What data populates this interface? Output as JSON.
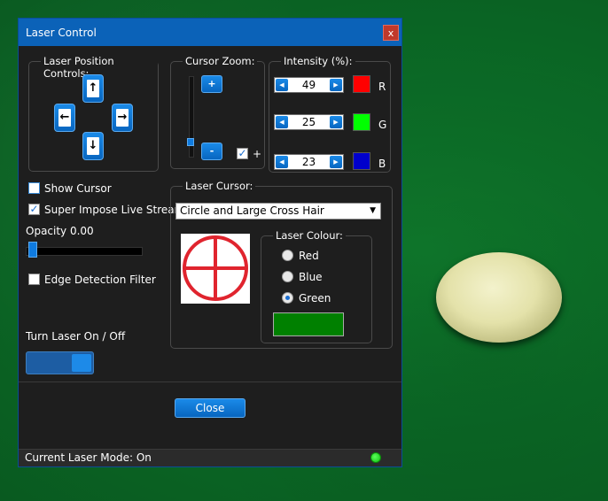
{
  "window": {
    "title": "Laser Control",
    "close_glyph": "x"
  },
  "position_controls": {
    "label": "Laser Position Controls:",
    "up_icon": "arrow-up-icon",
    "down_icon": "arrow-down-icon",
    "left_icon": "arrow-left-icon",
    "right_icon": "arrow-right-icon",
    "up_glyph": "↑",
    "down_glyph": "↓",
    "left_glyph": "←",
    "right_glyph": "→"
  },
  "cursor_zoom": {
    "label": "Cursor Zoom:",
    "plus": "+",
    "minus": "-",
    "check_label": "+",
    "checked": true,
    "level": 0.15
  },
  "intensity": {
    "label": "Intensity (%):",
    "channels": [
      {
        "letter": "R",
        "value": "49",
        "color": "#ff0000"
      },
      {
        "letter": "G",
        "value": "25",
        "color": "#00ff00"
      },
      {
        "letter": "B",
        "value": "23",
        "color": "#0000cc"
      }
    ]
  },
  "options": {
    "show_cursor": "Show Cursor",
    "super_impose": "Super Impose Live Stream",
    "opacity": "Opacity 0.00",
    "edge_detection": "Edge Detection Filter",
    "turn_laser": "Turn Laser On / Off"
  },
  "laser_cursor": {
    "label": "Laser Cursor:",
    "selected": "Circle and Large Cross Hair",
    "cursor_color": "#e0242e"
  },
  "laser_colour": {
    "label": "Laser Colour:",
    "options": [
      "Red",
      "Blue",
      "Green"
    ],
    "selected": "Green",
    "swatch": "#008000"
  },
  "buttons": {
    "close": "Close"
  },
  "status": {
    "text": "Current Laser Mode: On",
    "led_color": "#22dd22"
  }
}
